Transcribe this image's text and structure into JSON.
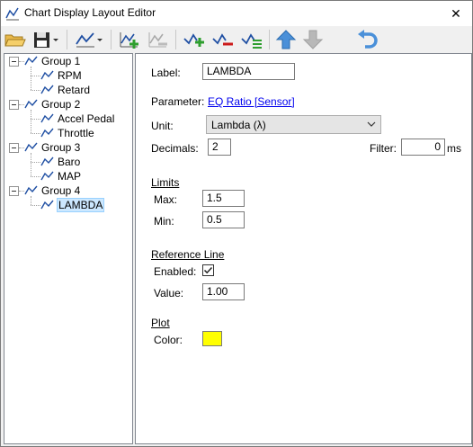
{
  "window": {
    "title": "Chart Display Layout Editor",
    "close_glyph": "✕"
  },
  "toolbar": {
    "buttons": [
      {
        "icon": "open-folder-icon"
      },
      {
        "icon": "save-icon"
      },
      {
        "icon": "chart-style-icon"
      },
      {
        "icon": "add-group-icon"
      },
      {
        "icon": "remove-group-icon"
      },
      {
        "icon": "add-channel-icon"
      },
      {
        "icon": "remove-channel-icon"
      },
      {
        "icon": "channel-properties-icon"
      },
      {
        "icon": "move-up-icon"
      },
      {
        "icon": "move-down-icon"
      },
      {
        "icon": "undo-icon"
      }
    ]
  },
  "tree": {
    "groups": [
      {
        "label": "Group 1",
        "children": [
          "RPM",
          "Retard"
        ]
      },
      {
        "label": "Group 2",
        "children": [
          "Accel Pedal",
          "Throttle"
        ]
      },
      {
        "label": "Group 3",
        "children": [
          "Baro",
          "MAP"
        ]
      },
      {
        "label": "Group 4",
        "children": [
          "LAMBDA"
        ]
      }
    ],
    "selected": "LAMBDA"
  },
  "props": {
    "label_caption": "Label:",
    "label_value": "LAMBDA",
    "parameter_caption": "Parameter:",
    "parameter_value": "EQ Ratio [Sensor]",
    "unit_caption": "Unit:",
    "unit_value": "Lambda (λ)",
    "decimals_caption": "Decimals:",
    "decimals_value": "2",
    "filter_caption": "Filter:",
    "filter_value": "0",
    "filter_unit": "ms",
    "limits_header": "Limits",
    "max_caption": "Max:",
    "max_value": "1.5",
    "min_caption": "Min:",
    "min_value": "0.5",
    "ref_header": "Reference Line",
    "enabled_caption": "Enabled:",
    "enabled_checked": true,
    "value_caption": "Value:",
    "ref_value": "1.00",
    "plot_header": "Plot",
    "color_caption": "Color:",
    "plot_color": "#ffff00"
  },
  "colors": {
    "accent_blue": "#4a90d9",
    "add_green": "#2e9e2e",
    "remove_red": "#cc1a1a",
    "chart_line": "#1f4fa3"
  }
}
